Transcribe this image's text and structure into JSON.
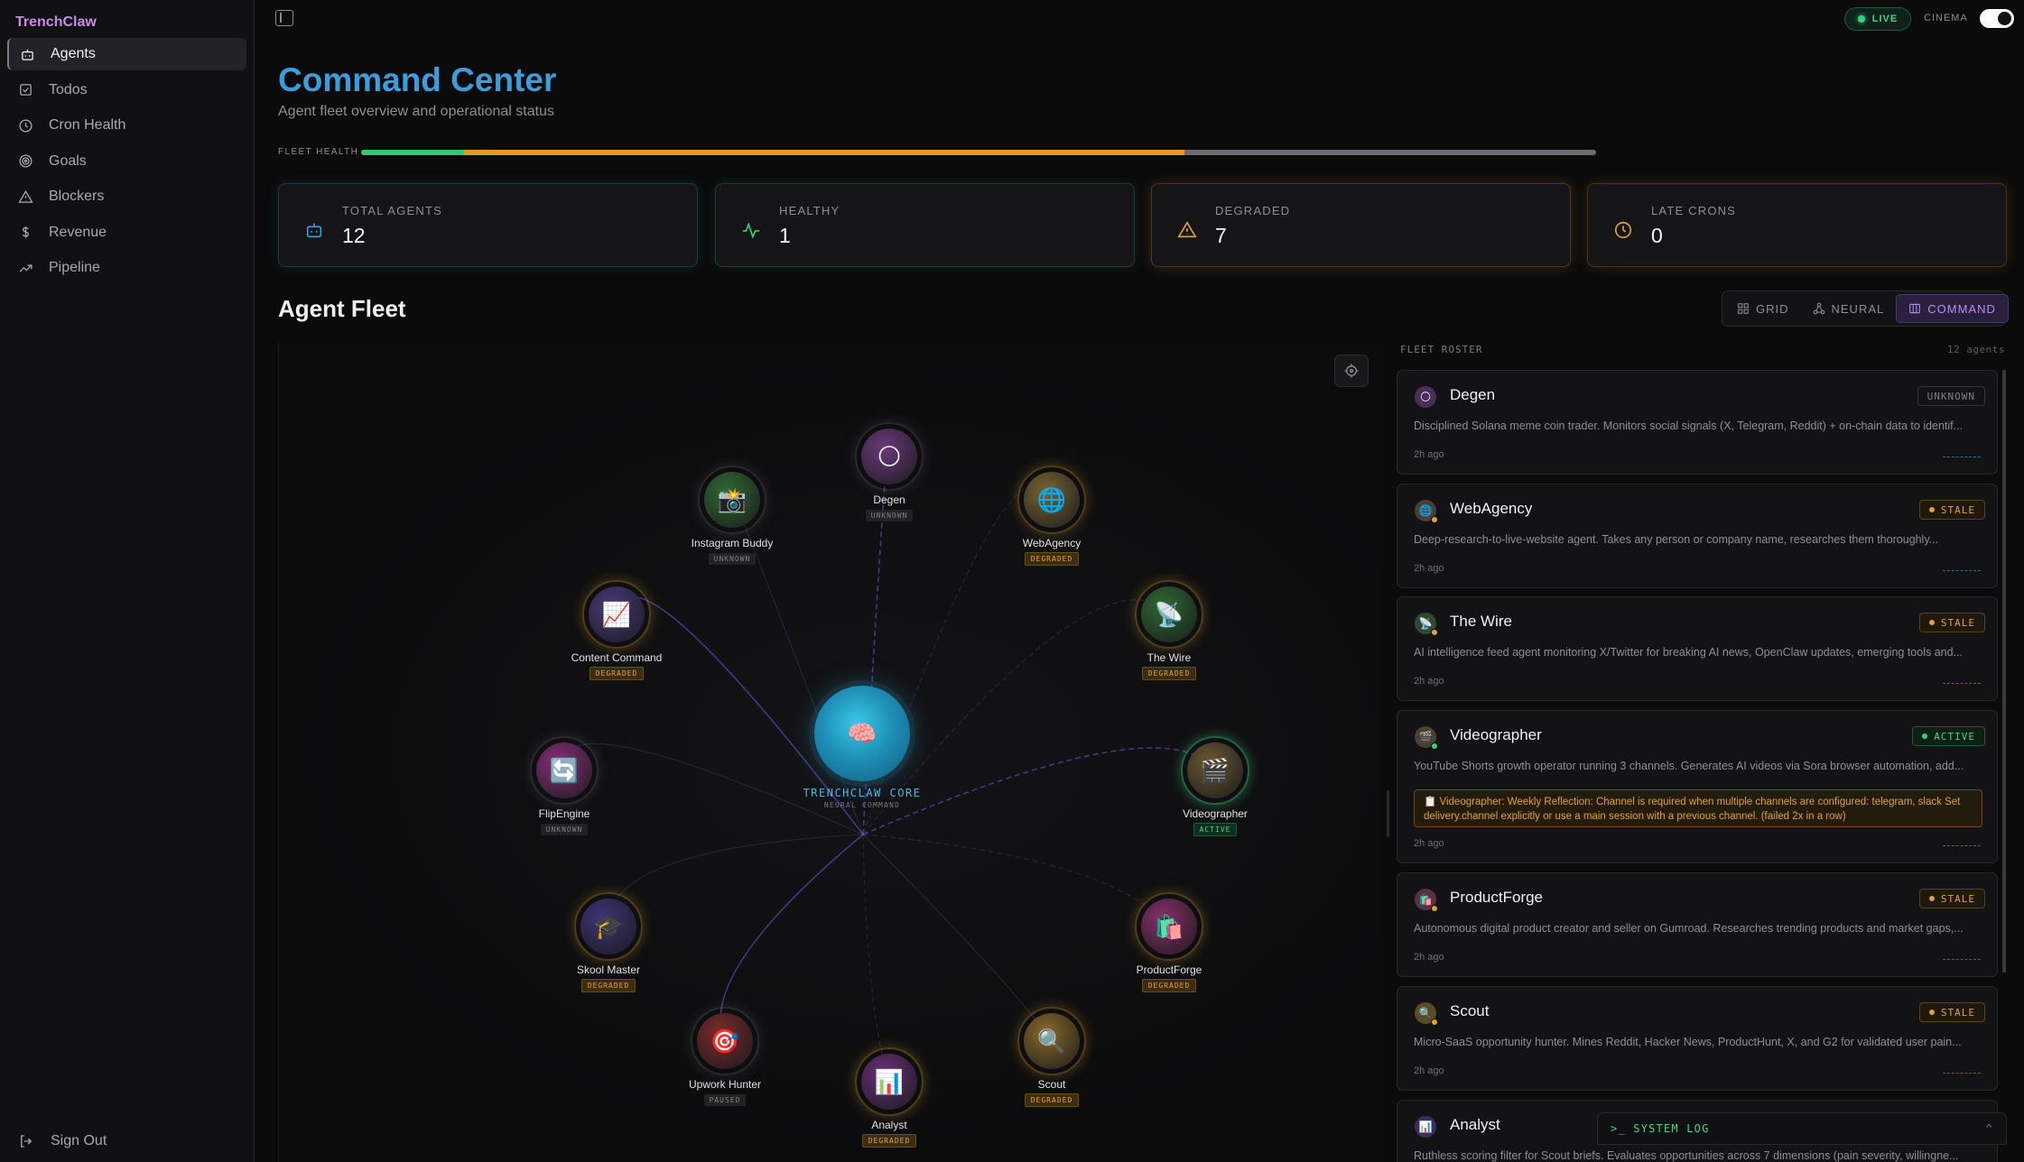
{
  "app": {
    "brand": "TrenchClaw"
  },
  "sidebar": {
    "items": [
      {
        "label": "Agents",
        "icon": "robot-icon"
      },
      {
        "label": "Todos",
        "icon": "checkbox-icon"
      },
      {
        "label": "Cron Health",
        "icon": "clock-icon"
      },
      {
        "label": "Goals",
        "icon": "target-icon"
      },
      {
        "label": "Blockers",
        "icon": "warning-icon"
      },
      {
        "label": "Revenue",
        "icon": "dollar-icon"
      },
      {
        "label": "Pipeline",
        "icon": "trending-up-icon"
      }
    ],
    "signout": "Sign Out"
  },
  "topbar": {
    "live": "LIVE",
    "cinema": "CINEMA"
  },
  "header": {
    "title": "Command Center",
    "subtitle": "Agent fleet overview and operational status",
    "fleet_health_label": "FLEET HEALTH",
    "fleet_health": {
      "healthy": 1,
      "degraded": 7,
      "other": 4,
      "total": 12
    }
  },
  "stats": [
    {
      "label": "TOTAL AGENTS",
      "value": "12",
      "color": "#3b9ddc"
    },
    {
      "label": "HEALTHY",
      "value": "1",
      "color": "#36d27c"
    },
    {
      "label": "DEGRADED",
      "value": "7",
      "color": "#e0a23a"
    },
    {
      "label": "LATE CRONS",
      "value": "0",
      "color": "#e0a23a"
    }
  ],
  "fleet": {
    "title": "Agent Fleet",
    "views": [
      "GRID",
      "NEURAL",
      "COMMAND"
    ],
    "core": {
      "title": "TRENCHCLAW CORE",
      "subtitle": "NEURAL COMMAND"
    },
    "nodes": [
      {
        "name": "Degen",
        "status": "UNKNOWN",
        "emoji": "🌕",
        "color": "#6b3a7a"
      },
      {
        "name": "Instagram Buddy",
        "status": "UNKNOWN",
        "emoji": "📸",
        "color": "#2f6a32"
      },
      {
        "name": "WebAgency",
        "status": "DEGRADED",
        "emoji": "🌐",
        "color": "#7a6430"
      },
      {
        "name": "Content Command",
        "status": "DEGRADED",
        "emoji": "📈",
        "color": "#4a3a7a"
      },
      {
        "name": "The Wire",
        "status": "DEGRADED",
        "emoji": "📡",
        "color": "#2f6a32"
      },
      {
        "name": "FlipEngine",
        "status": "UNKNOWN",
        "emoji": "🔄",
        "color": "#8a2f7a"
      },
      {
        "name": "Videographer",
        "status": "ACTIVE",
        "emoji": "🎬",
        "color": "#6a5830"
      },
      {
        "name": "Skool Master",
        "status": "DEGRADED",
        "emoji": "🎓",
        "color": "#3f3478"
      },
      {
        "name": "ProductForge",
        "status": "DEGRADED",
        "emoji": "🛍️",
        "color": "#8a2f6a"
      },
      {
        "name": "Upwork Hunter",
        "status": "PAUSED",
        "emoji": "🎯",
        "color": "#7a2a2a"
      },
      {
        "name": "Analyst",
        "status": "DEGRADED",
        "emoji": "📊",
        "color": "#6a2f7a"
      },
      {
        "name": "Scout",
        "status": "DEGRADED",
        "emoji": "🔍",
        "color": "#8a6a28"
      }
    ]
  },
  "roster": {
    "label": "FLEET ROSTER",
    "count": "12 agents",
    "cards": [
      {
        "name": "Degen",
        "status": "UNKNOWN",
        "emoji": "🌕",
        "desc": "Disciplined Solana meme coin trader. Monitors social signals (X, Telegram, Reddit) + on-chain data to identif...",
        "time": "2h ago"
      },
      {
        "name": "WebAgency",
        "status": "STALE",
        "emoji": "🌐",
        "desc": "Deep-research-to-live-website agent. Takes any person or company name, researches them thoroughly...",
        "time": "2h ago"
      },
      {
        "name": "The Wire",
        "status": "STALE",
        "emoji": "📡",
        "desc": "AI intelligence feed agent monitoring X/Twitter for breaking AI news, OpenClaw updates, emerging tools and...",
        "time": "2h ago"
      },
      {
        "name": "Videographer",
        "status": "ACTIVE",
        "emoji": "🎬",
        "desc": "YouTube Shorts growth operator running 3 channels. Generates AI videos via Sora browser automation, add...",
        "warning": "📋 Videographer: Weekly Reflection: Channel is required when multiple channels are configured: telegram, slack Set delivery.channel explicitly or use a main session with a previous channel. (failed 2x in a row)",
        "time": "2h ago"
      },
      {
        "name": "ProductForge",
        "status": "STALE",
        "emoji": "🛍️",
        "desc": "Autonomous digital product creator and seller on Gumroad. Researches trending products and market gaps,...",
        "time": "2h ago"
      },
      {
        "name": "Scout",
        "status": "STALE",
        "emoji": "🔍",
        "desc": "Micro-SaaS opportunity hunter. Mines Reddit, Hacker News, ProductHunt, X, and G2 for validated user pain...",
        "time": "2h ago"
      },
      {
        "name": "Analyst",
        "status": "",
        "emoji": "📊",
        "desc": "Ruthless scoring filter for Scout briefs. Evaluates opportunities across 7 dimensions (pain severity, willingne...",
        "time": ""
      }
    ]
  },
  "syslog": {
    "label": ">_ SYSTEM LOG"
  }
}
